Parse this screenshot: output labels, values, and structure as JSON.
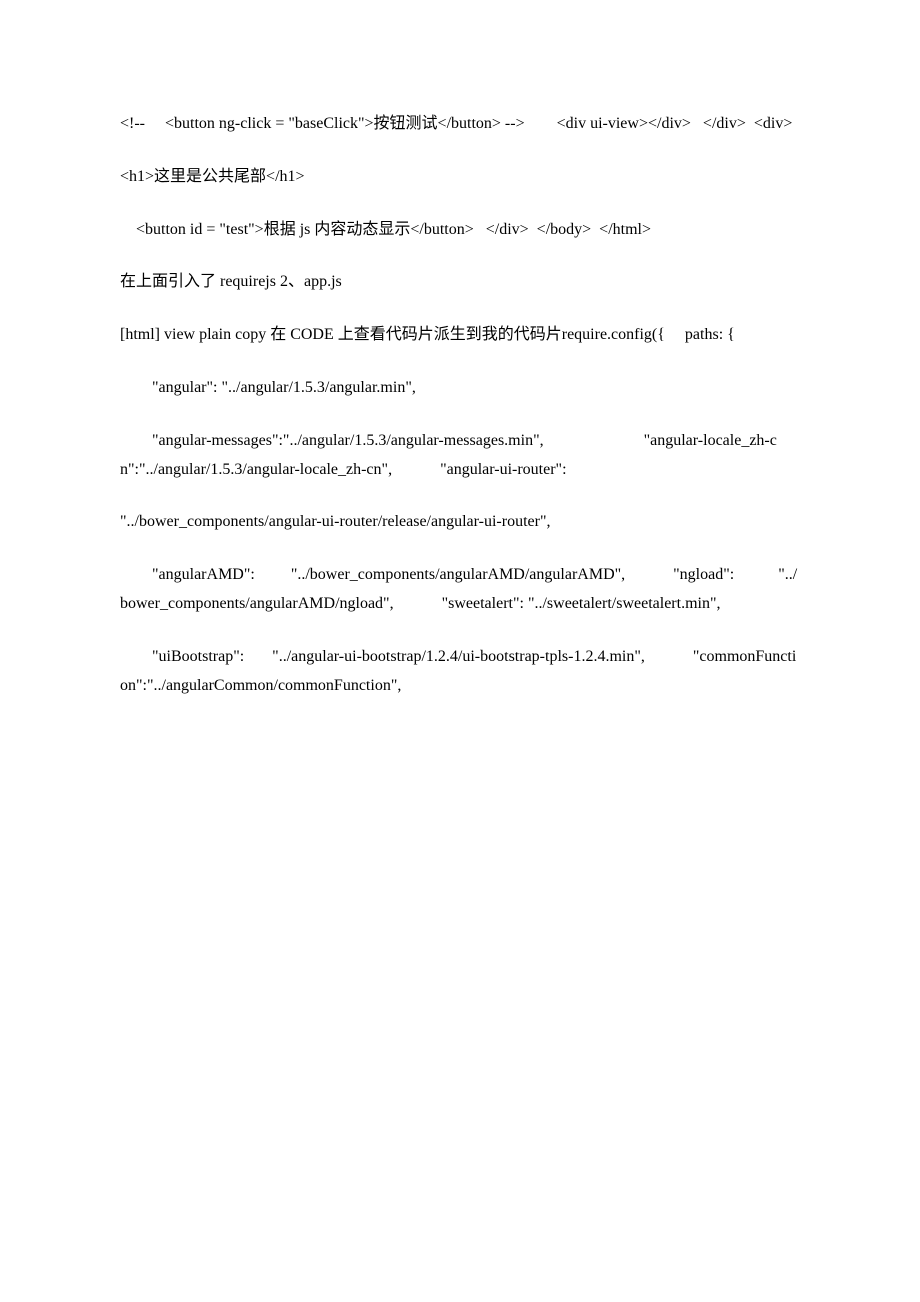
{
  "paragraphs": [
    "<!--     <button ng-click = \"baseClick\">按钮测试</button> -->        <div ui-view></div>   </div>  <div>",
    "<h1>这里是公共尾部</h1>",
    "    <button id = \"test\">根据 js 内容动态显示</button>   </div>  </body>  </html>",
    "在上面引入了 requirejs 2、app.js",
    "[html] view plain copy 在 CODE 上查看代码片派生到我的代码片require.config({     paths: {",
    "        \"angular\": \"../angular/1.5.3/angular.min\",",
    "        \"angular-messages\":\"../angular/1.5.3/angular-messages.min\",                         \"angular-locale_zh-cn\":\"../angular/1.5.3/angular-locale_zh-cn\",            \"angular-ui-router\":",
    "\"../bower_components/angular-ui-router/release/angular-ui-router\",",
    "        \"angularAMD\":         \"../bower_components/angularAMD/angularAMD\",            \"ngload\":           \"../bower_components/angularAMD/ngload\",            \"sweetalert\": \"../sweetalert/sweetalert.min\",",
    "        \"uiBootstrap\":       \"../angular-ui-bootstrap/1.2.4/ui-bootstrap-tpls-1.2.4.min\",            \"commonFunction\":\"../angularCommon/commonFunction\","
  ]
}
